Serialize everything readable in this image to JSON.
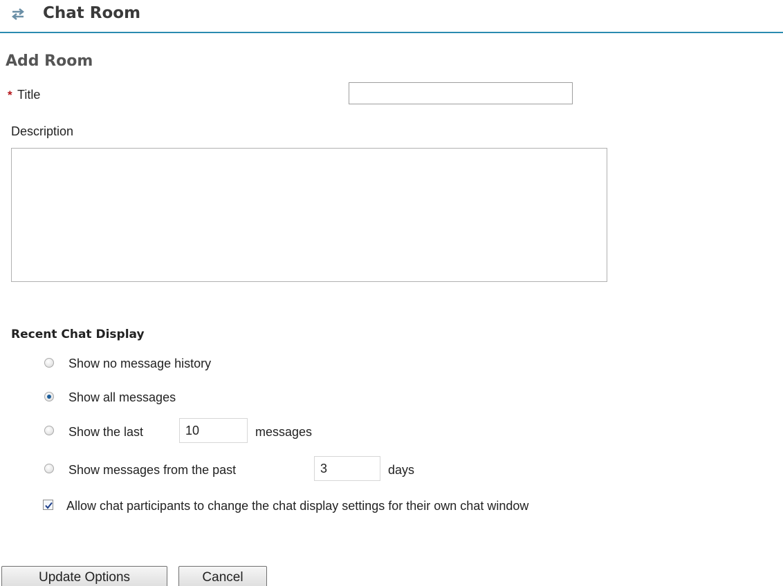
{
  "header": {
    "title": "Chat Room",
    "icon": "swap-arrows-icon"
  },
  "form": {
    "section_title": "Add Room",
    "title_field": {
      "required_marker": "*",
      "label": "Title",
      "value": ""
    },
    "description_field": {
      "label": "Description",
      "value": ""
    }
  },
  "recent_chat_display": {
    "heading": "Recent Chat Display",
    "selected": "all",
    "options": {
      "none": {
        "label": "Show no message history"
      },
      "all": {
        "label": "Show all messages"
      },
      "last": {
        "prefix": "Show the last",
        "value": "10",
        "suffix": "messages"
      },
      "past": {
        "prefix": "Show messages from the past",
        "value": "3",
        "suffix": "days"
      }
    },
    "allow_change": {
      "checked": true,
      "label": "Allow chat participants to change the chat display settings for their own chat window"
    }
  },
  "buttons": {
    "update": "Update Options",
    "cancel": "Cancel"
  },
  "colors": {
    "accent": "#2a8bb0",
    "required": "#b4161b",
    "radio_selected": "#1d5e9a"
  }
}
